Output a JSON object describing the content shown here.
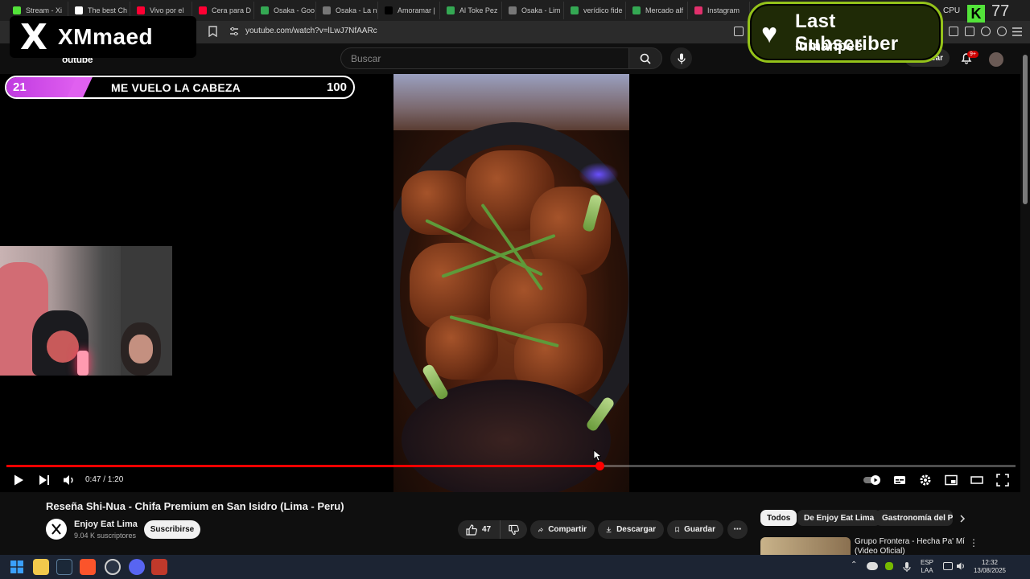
{
  "browser": {
    "tabs": [
      {
        "label": "Stream - Xi",
        "color": "#53e33a"
      },
      {
        "label": "The best Ch",
        "color": "#ffffff"
      },
      {
        "label": "Vivo por el",
        "color": "#ff0033"
      },
      {
        "label": "Cera para D",
        "color": "#ff0033"
      },
      {
        "label": "Osaka - Goo",
        "color": "#34a853"
      },
      {
        "label": "Osaka - La n",
        "color": "#777777"
      },
      {
        "label": "Amoramar |",
        "color": "#000000"
      },
      {
        "label": "Al Toke Pez",
        "color": "#34a853"
      },
      {
        "label": "Osaka - Lim",
        "color": "#777777"
      },
      {
        "label": "verídico fide",
        "color": "#34a853"
      },
      {
        "label": "Mercado alf",
        "color": "#34a853"
      },
      {
        "label": "Instagram",
        "color": "#e1306c"
      }
    ],
    "url": "youtube.com/watch?v=lLwJ7NfAARc"
  },
  "overlay": {
    "brand_x": "X",
    "brand_name": "XMmaed",
    "goal": {
      "current": "21",
      "title": "ME VUELO LA CABEZA",
      "target": "100",
      "progress": 0.21
    },
    "last_subscriber": {
      "heading": "Last Subscriber",
      "name": "lumanpee"
    },
    "cpu": {
      "label": "CPU",
      "k": "K",
      "value": "77"
    }
  },
  "youtube": {
    "logo_text": "outube",
    "search_placeholder": "Buscar",
    "create_label": "Crear",
    "notif_count": "9+"
  },
  "player": {
    "time": "0:47 / 1:20",
    "progress": 0.5875
  },
  "video": {
    "title": "Reseña Shi-Nua - Chifa Premium en San Isidro (Lima - Peru)",
    "channel": "Enjoy Eat Lima",
    "subscribers": "9.04 K suscriptores",
    "subscribe_label": "Suscribirse",
    "likes": "47",
    "share_label": "Compartir",
    "download_label": "Descargar",
    "save_label": "Guardar"
  },
  "sidebar": {
    "chips": [
      "Todos",
      "De Enjoy Eat Lima",
      "Gastronomía del P"
    ],
    "rec_title": "Grupo Frontera - Hecha Pa' Mí (Video Oficial)"
  },
  "taskbar": {
    "lang_line1": "ESP",
    "lang_line2": "LAA",
    "clock_time": "12:32",
    "clock_date": "13/08/2025"
  },
  "colors": {
    "accent_red": "#ff0000",
    "goal_purple": "#d04ae8",
    "sub_green": "#94c21a"
  }
}
